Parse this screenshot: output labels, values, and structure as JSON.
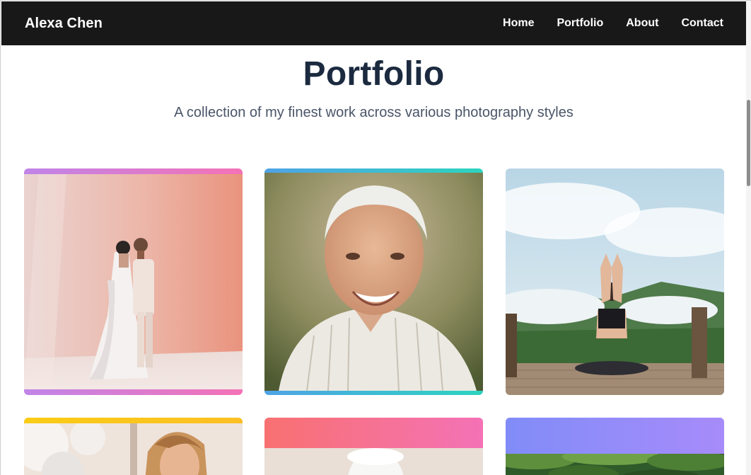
{
  "navbar": {
    "brand": "Alexa Chen",
    "links": [
      "Home",
      "Portfolio",
      "About",
      "Contact"
    ]
  },
  "header": {
    "title": "Portfolio",
    "subtitle": "A collection of my finest work across various photography styles"
  },
  "gallery": {
    "items": [
      {
        "photo": "wedding-couple-photo",
        "accent": [
          "#c084e8",
          "#f472b6"
        ]
      },
      {
        "photo": "elderly-man-portrait-photo",
        "accent": [
          "#4fa3e6",
          "#2dd4bf"
        ]
      },
      {
        "photo": "mountain-yoga-photo",
        "accent": []
      },
      {
        "photo": "woman-balloons-photo",
        "accent": [
          "#facc15",
          "#fbbf24"
        ]
      },
      {
        "photo": "chef-hat-photo",
        "accent": [
          "#f87171",
          "#f472b6"
        ]
      },
      {
        "photo": "forest-canopy-photo",
        "accent": [
          "#818cf8",
          "#a78bfa"
        ]
      }
    ]
  },
  "colors": {
    "navbar_bg": "#181818",
    "title": "#1b2a3f",
    "subtitle": "#4a5568"
  }
}
